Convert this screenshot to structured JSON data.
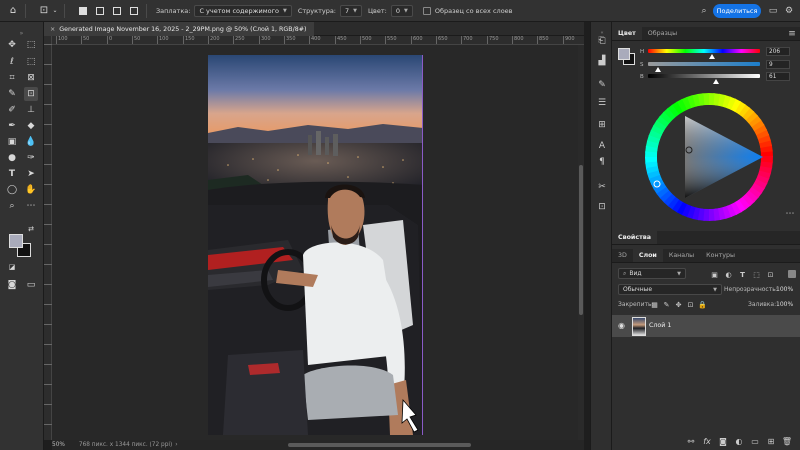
{
  "optbar": {
    "fill_label": "Заплатка:",
    "fill_value": "С учетом содержимого",
    "structure_label": "Структура:",
    "structure_value": "7",
    "color_label": "Цвет:",
    "color_value": "0",
    "sample_label": "Образец со всех слоев",
    "share_label": "Поделиться"
  },
  "document": {
    "tab_title": "Generated Image November 16, 2025 - 2_29PM.png @ 50% (Слой 1, RGB/8#)"
  },
  "ruler": {
    "top_numbers": [
      "100",
      "50",
      "0",
      "50",
      "100",
      "150",
      "200",
      "250",
      "300",
      "350",
      "400",
      "450",
      "500",
      "550",
      "600",
      "650",
      "700",
      "750",
      "800",
      "850",
      "900"
    ]
  },
  "status": {
    "zoom": "50%",
    "dimensions": "768 пикс. x 1344 пикс. (72 ppi)",
    "arrow": "›"
  },
  "color_panel": {
    "tabs": [
      "Цвет",
      "Образцы"
    ],
    "h_label": "H",
    "s_label": "S",
    "b_label": "B",
    "h_value": "206",
    "s_value": "9",
    "b_value": "61",
    "h": 206,
    "s": 9,
    "b": 61,
    "foreground": "#a9abbb",
    "background": "#111111"
  },
  "properties_panel": {
    "tabs": [
      "Свойства"
    ]
  },
  "layers_panel": {
    "tabs": [
      "3D",
      "Слои",
      "Каналы",
      "Контуры"
    ],
    "filter_label": "Вид",
    "blend_mode": "Обычные",
    "opacity_label": "Непрозрачность:",
    "opacity_value": "100%",
    "lock_label": "Закрепить:",
    "fill_label": "Заливка:",
    "fill_value": "100%",
    "layers": [
      {
        "name": "Слой 1",
        "visible": true
      }
    ]
  },
  "colors": {
    "accent": "#1473e6",
    "panel": "#2f2f2f",
    "canvas_bg": "#282828",
    "selection": "#4a4a4a"
  },
  "icons": {
    "tools": [
      "move-icon",
      "marquee-icon",
      "lasso-icon",
      "object-select-icon",
      "crop-icon",
      "frame-icon",
      "eyedropper-icon",
      "spot-heal-icon",
      "brush-icon",
      "stamp-icon",
      "history-brush-icon",
      "eraser-icon",
      "gradient-icon",
      "blur-icon",
      "dodge-icon",
      "pen-icon",
      "type-icon",
      "path-select-icon",
      "shape-icon",
      "hand-icon",
      "zoom-icon",
      "more-icon"
    ]
  }
}
